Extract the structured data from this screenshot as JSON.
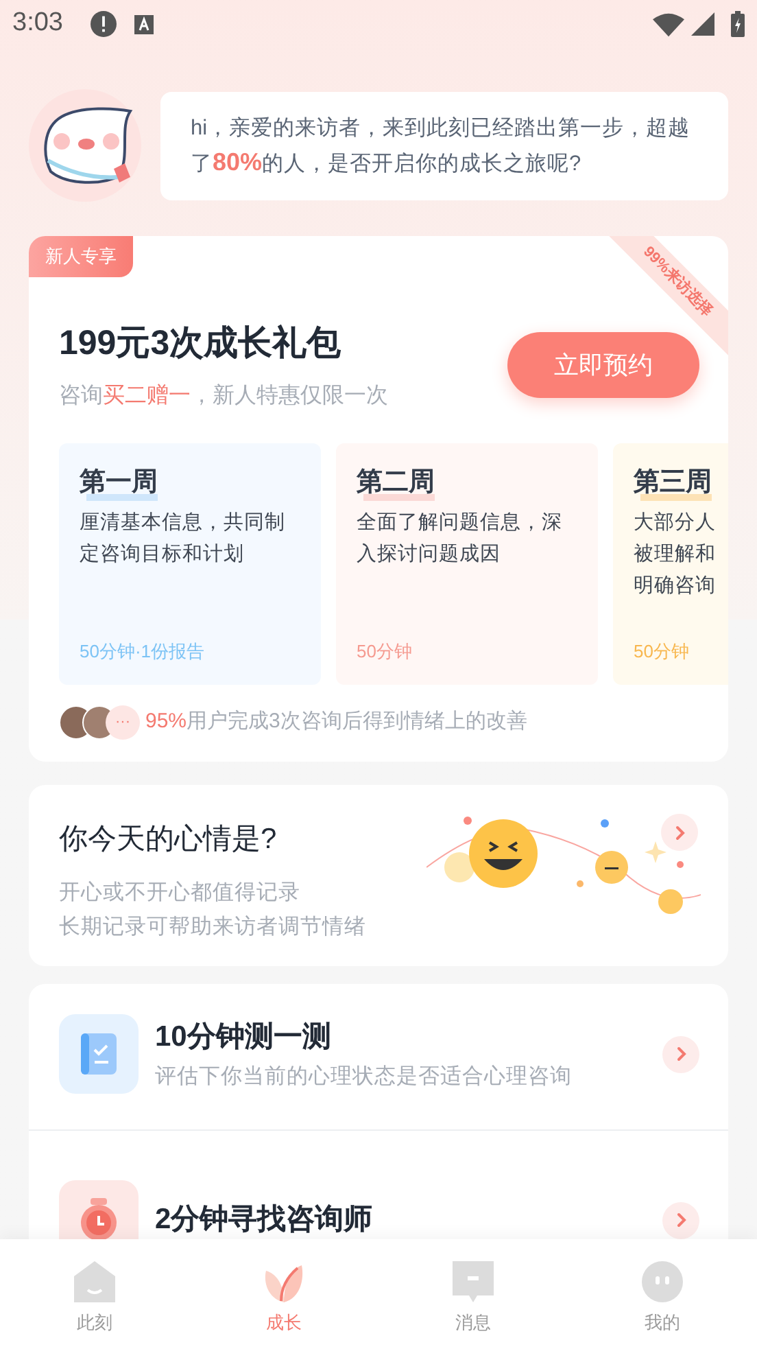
{
  "status_bar": {
    "time": "3:03"
  },
  "greeting": {
    "text": "hi，亲爱的来访者，来到此刻已经踏出第一步，超越了**80%**的人，是否开启你的成长之旅呢?"
  },
  "package": {
    "badge": "新人专享",
    "ribbon": "99%来访选择",
    "title": "199元3次成长礼包",
    "subtitle_prefix": "咨询",
    "subtitle_highlight": "买二赠一",
    "subtitle_suffix": "，新人特惠仅限一次",
    "button": "立即预约",
    "weeks": [
      {
        "kind": "blue",
        "title": "第一周",
        "lines": [
          "厘清基本信息，共同制",
          "定咨询目标和计划"
        ],
        "meta": "50分钟·1份报告"
      },
      {
        "kind": "red",
        "title": "第二周",
        "lines": [
          "全面了解问题信息，深",
          "入探讨问题成因"
        ],
        "meta": "50分钟"
      },
      {
        "kind": "yellow",
        "title": "第三周",
        "lines": [
          "大部分人",
          "被理解和",
          "明确咨询"
        ],
        "meta": "50分钟"
      }
    ],
    "more_icon": "···",
    "stat_highlight": "95%",
    "stat_text": "用户完成3次咨询后得到情绪上的改善"
  },
  "mood": {
    "title": "你今天的心情是?",
    "lines": [
      "开心或不开心都值得记录",
      "长期记录可帮助来访者调节情绪"
    ]
  },
  "actions": [
    {
      "kind": "test",
      "title": "10分钟测一测",
      "subtitle": "评估下你当前的心理状态是否适合心理咨询"
    },
    {
      "kind": "timer",
      "title": "2分钟寻找咨询师"
    }
  ],
  "tabs": [
    {
      "kind": "home",
      "label": "此刻",
      "selected": false
    },
    {
      "kind": "leaf",
      "label": "成长",
      "selected": true
    },
    {
      "kind": "message",
      "label": "消息",
      "selected": false
    },
    {
      "kind": "face",
      "label": "我的",
      "selected": false
    }
  ]
}
